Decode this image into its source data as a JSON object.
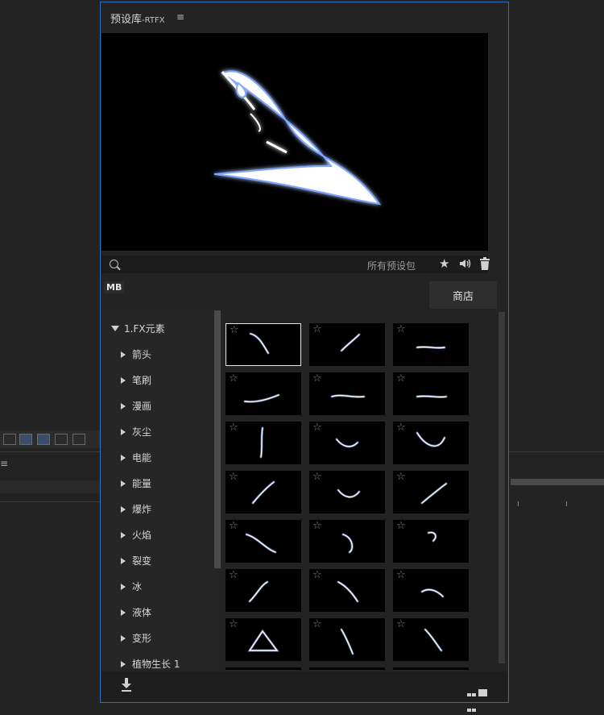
{
  "panel": {
    "title": "预设库",
    "title_sub": "-RTFX",
    "menu_icon": "hamburger-icon"
  },
  "search": {
    "placeholder": "",
    "value": "",
    "pack_label": "所有预设包"
  },
  "toolbar_icons": [
    "star-icon",
    "speaker-icon",
    "trash-icon"
  ],
  "mb_label": "MB",
  "store_label": "商店",
  "tree": {
    "root": "1.FX元素",
    "items": [
      "箭头",
      "笔刷",
      "漫画",
      "灰尘",
      "电能",
      "能量",
      "爆炸",
      "火焰",
      "裂变",
      "冰",
      "液体",
      "变形",
      "植物生长 1"
    ]
  },
  "grid": {
    "thumbnails": [
      {
        "selected": true
      },
      {
        "selected": false
      },
      {
        "selected": false
      },
      {
        "selected": false
      },
      {
        "selected": false
      },
      {
        "selected": false
      },
      {
        "selected": false
      },
      {
        "selected": false
      },
      {
        "selected": false
      },
      {
        "selected": false
      },
      {
        "selected": false
      },
      {
        "selected": false
      },
      {
        "selected": false
      },
      {
        "selected": false
      },
      {
        "selected": false
      },
      {
        "selected": false
      },
      {
        "selected": false
      },
      {
        "selected": false
      },
      {
        "selected": false
      },
      {
        "selected": false
      },
      {
        "selected": false
      }
    ],
    "star_icon": "star-outline-icon"
  },
  "footer_icons": [
    "download-icon",
    "grid-view-icon"
  ],
  "colors": {
    "panel_border": "#2f6fbf",
    "glow": "#8fb4ff",
    "background": "#232323"
  }
}
